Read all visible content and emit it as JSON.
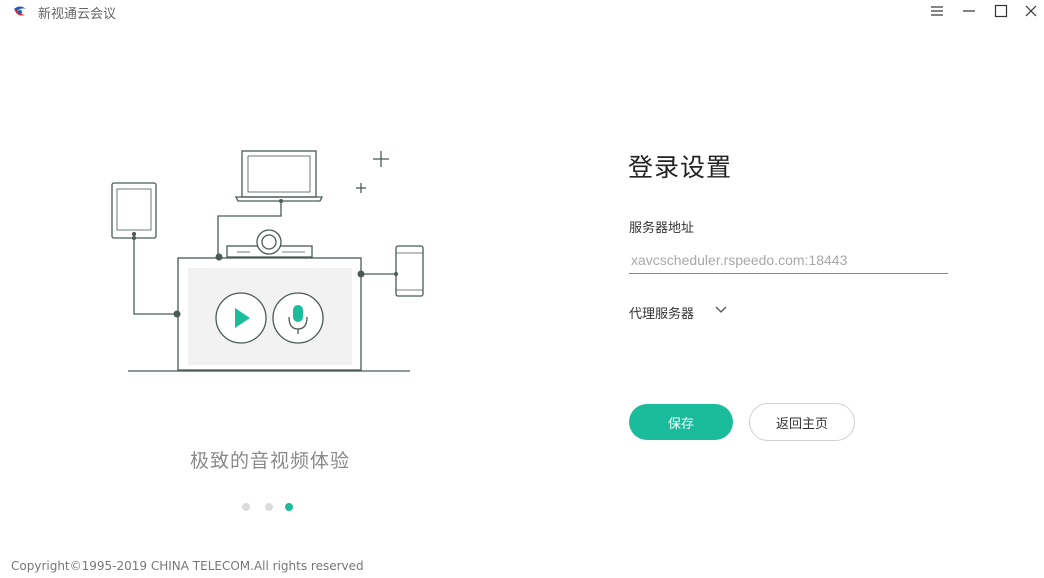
{
  "app": {
    "title": "新视通云会议",
    "logo_icon": "china-telecom-logo",
    "window_controls": [
      "menu-icon",
      "minimize-icon",
      "maximize-icon",
      "close-icon"
    ]
  },
  "carousel": {
    "slogan": "极致的音视频体验",
    "pages": 3,
    "active_page": 3
  },
  "form": {
    "title": "登录设置",
    "server_label": "服务器地址",
    "server_placeholder": "xavcscheduler.rspeedo.com:18443",
    "proxy_label": "代理服务器",
    "save_label": "保存",
    "back_label": "返回主页"
  },
  "footer": {
    "copyright": "Copyright©1995-2019 CHINA TELECOM.All rights reserved"
  },
  "colors": {
    "accent": "#1abc9c",
    "illustration_line": "#4a5a55"
  }
}
